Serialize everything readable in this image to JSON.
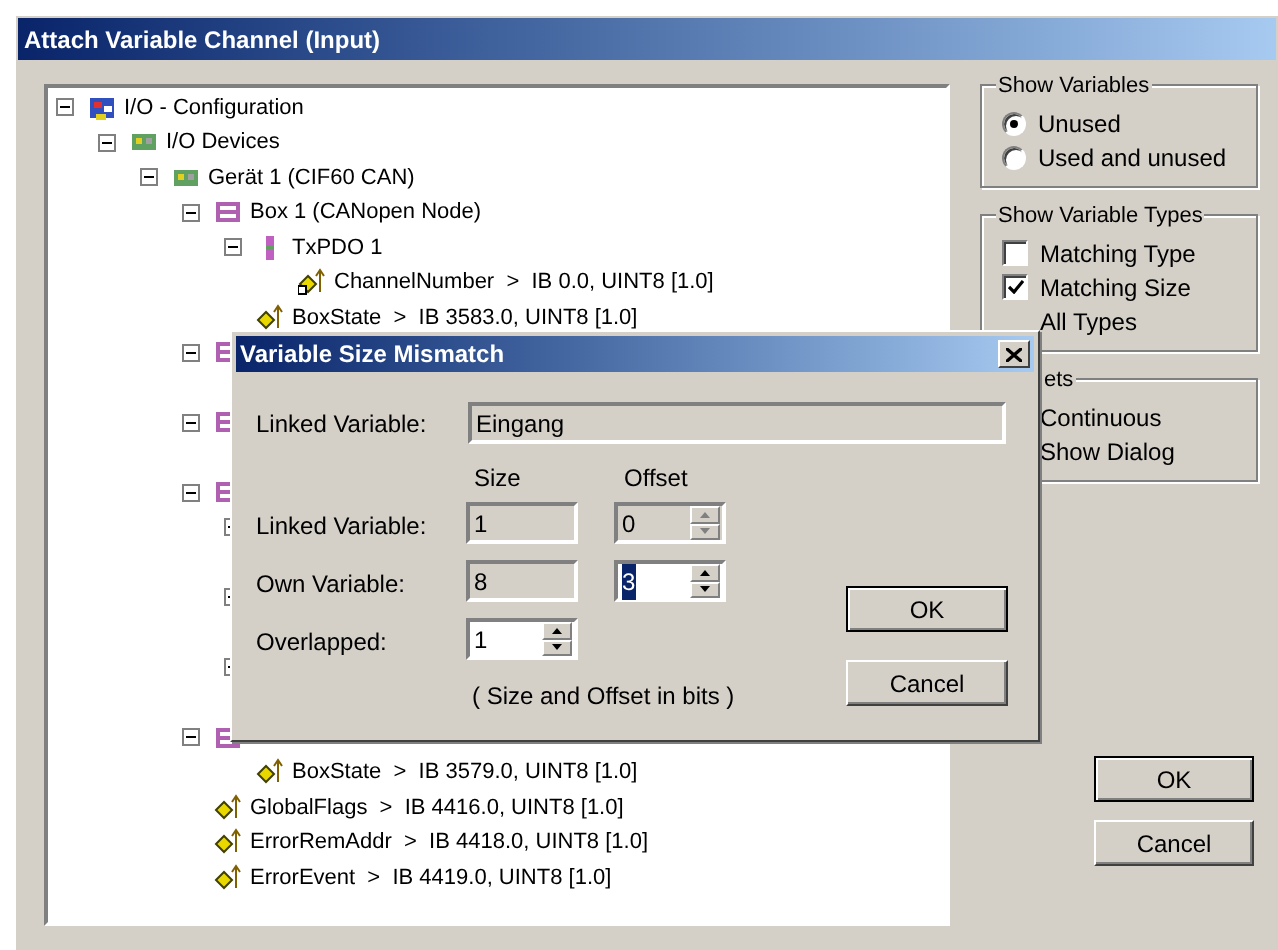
{
  "window": {
    "title": "Attach Variable Channel (Input)"
  },
  "tree": [
    {
      "label": "I/O - Configuration",
      "kind": "network",
      "expanded": true,
      "children": [
        {
          "label": "I/O Devices",
          "kind": "devices",
          "expanded": true,
          "children": [
            {
              "label": "Gerät 1 (CIF60 CAN)",
              "kind": "devices",
              "expanded": true,
              "children": [
                {
                  "label": "Box 1 (CANopen Node)",
                  "kind": "box",
                  "expanded": true,
                  "children": [
                    {
                      "label": "TxPDO 1",
                      "kind": "pdo",
                      "expanded": true,
                      "children": [
                        {
                          "label": "ChannelNumber  >  IB 0.0, UINT8 [1.0]",
                          "kind": "variable-linked"
                        }
                      ]
                    },
                    {
                      "label": "BoxState  >  IB 3583.0, UINT8 [1.0]",
                      "kind": "variable"
                    }
                  ]
                },
                {
                  "kind": "box",
                  "expanded": true
                },
                {
                  "kind": "box",
                  "expanded": true
                },
                {
                  "kind": "box",
                  "expanded": true,
                  "children": [
                    {
                      "expanded": true
                    },
                    {
                      "expanded": true
                    },
                    {
                      "expanded": true
                    }
                  ]
                },
                {
                  "kind": "box",
                  "expanded": true,
                  "children": [
                    {
                      "label": "BoxState  >  IB 3579.0, UINT8 [1.0]",
                      "kind": "variable"
                    }
                  ]
                },
                {
                  "label": "GlobalFlags  >  IB 4416.0, UINT8 [1.0]",
                  "kind": "variable"
                },
                {
                  "label": "ErrorRemAddr  >  IB 4418.0, UINT8 [1.0]",
                  "kind": "variable"
                },
                {
                  "label": "ErrorEvent  >  IB 4419.0, UINT8 [1.0]",
                  "kind": "variable"
                }
              ]
            }
          ]
        }
      ]
    }
  ],
  "groups": [
    {
      "title": "Show Variables",
      "items": [
        {
          "kind": "radio",
          "label": "Unused",
          "selected": true
        },
        {
          "kind": "radio",
          "label": "Used and unused",
          "selected": false
        }
      ]
    },
    {
      "title": "Show Variable Types",
      "items": [
        {
          "kind": "checkbox",
          "label": "Matching Type",
          "checked": false
        },
        {
          "kind": "checkbox",
          "label": "Matching Size",
          "checked": true
        },
        {
          "kind": "covered",
          "label": "All Types"
        }
      ]
    },
    {
      "title": "ets",
      "title_covered": true,
      "items": [
        {
          "kind": "covered",
          "label": "Continuous"
        },
        {
          "kind": "covered",
          "label": "Show Dialog"
        }
      ]
    }
  ],
  "buttons": [
    {
      "label": "OK",
      "default": true
    },
    {
      "label": "Cancel",
      "default": false
    }
  ],
  "dialog": {
    "title": "Variable Size Mismatch",
    "linked_label": "Linked Variable:",
    "linked_value": "Eingang",
    "columns": [
      "Size",
      "Offset"
    ],
    "rows": [
      {
        "label": "Linked Variable:",
        "size": {
          "value": "1",
          "kind": "text",
          "disabled": true
        },
        "offset": {
          "value": "0",
          "kind": "spin",
          "disabled": true,
          "selected": false
        }
      },
      {
        "label": "Own Variable:",
        "size": {
          "value": "8",
          "kind": "text",
          "disabled": true
        },
        "offset": {
          "value": "3",
          "kind": "spin",
          "disabled": false,
          "selected": true
        }
      },
      {
        "label": "Overlapped:",
        "size": {
          "value": "1",
          "kind": "spin",
          "disabled": false
        }
      }
    ],
    "note": "( Size and Offset in bits )",
    "buttons": [
      {
        "label": "OK",
        "default": true
      },
      {
        "label": "Cancel",
        "default": false
      }
    ]
  }
}
